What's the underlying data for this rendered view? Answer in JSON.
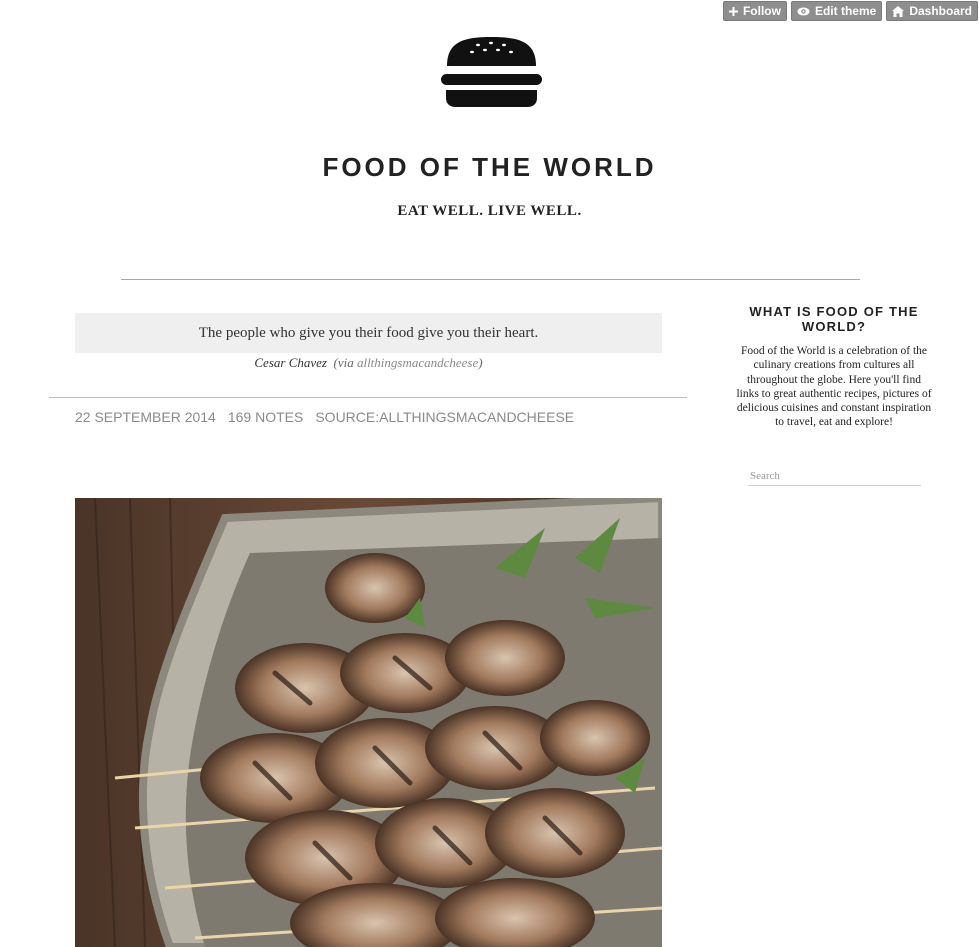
{
  "controls": {
    "follow_label": "Follow",
    "edit_theme_label": "Edit theme",
    "dashboard_label": "Dashboard"
  },
  "header": {
    "logo_icon": "burger-icon",
    "title": "FOOD OF THE WORLD",
    "subtitle": "EAT WELL. LIVE WELL."
  },
  "post": {
    "quote": "The people who give you their food give you their heart.",
    "source_name": "Cesar Chavez",
    "via_prefix": "(via",
    "via_link": "allthingsmacandcheese",
    "via_suffix": ")",
    "date": "22 SEPTEMBER 2014",
    "notes": "169 NOTES",
    "source": "SOURCE:ALLTHINGSMACANDCHEESE",
    "photo_alt": "grilled chicken skewers with herbs"
  },
  "sidebar": {
    "title": "WHAT IS FOOD OF THE WORLD?",
    "description": "Food of the World is a celebration of the culinary creations from cultures all throughout the globe. Here you'll find links to great authentic recipes, pictures of delicious cuisines and constant inspiration to travel, eat and explore!",
    "search_placeholder": "Search"
  },
  "colors": {
    "control_bg": "#8e8e8e",
    "quote_bg": "#efefef",
    "meta_text": "#8a8a8a"
  }
}
